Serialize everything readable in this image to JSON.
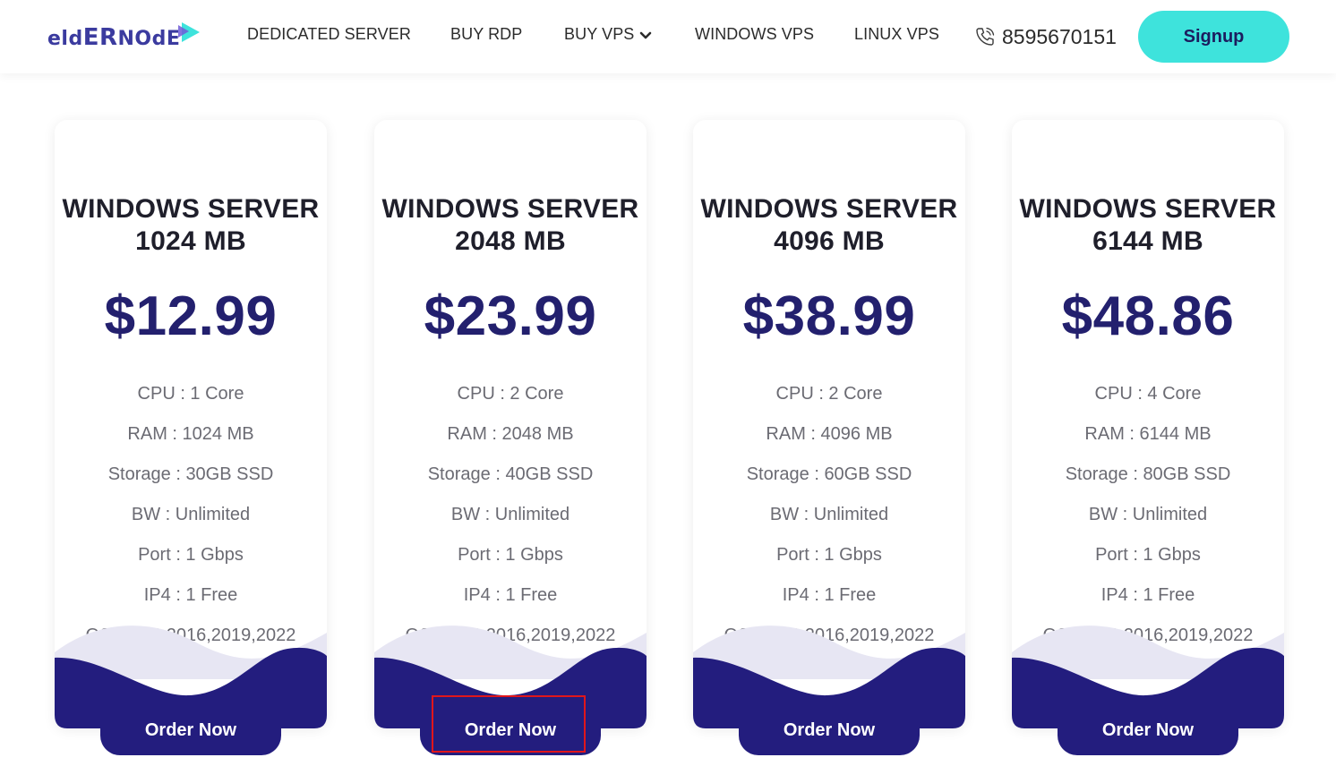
{
  "brand": {
    "logo_text_prefix": "eld",
    "logo_text_middle": "ER",
    "logo_text_suffix": "NOdE"
  },
  "nav": {
    "items": [
      "DEDICATED SERVER",
      "BUY RDP",
      "BUY VPS",
      "WINDOWS VPS",
      "LINUX VPS"
    ]
  },
  "contact": {
    "phone": "8595670151"
  },
  "signup_label": "Signup",
  "plans": [
    {
      "title_line1": "WINDOWS SERVER",
      "title_line2": "1024 MB",
      "price": "$12.99",
      "features": [
        "CPU : 1 Core",
        "RAM : 1024 MB",
        "Storage : 30GB SSD",
        "BW : Unlimited",
        "Port : 1 Gbps",
        "IP4 : 1 Free",
        "OS: 2012,2016,2019,2022"
      ],
      "order_label": "Order Now"
    },
    {
      "title_line1": "WINDOWS SERVER",
      "title_line2": "2048 MB",
      "price": "$23.99",
      "features": [
        "CPU : 2 Core",
        "RAM : 2048 MB",
        "Storage : 40GB SSD",
        "BW : Unlimited",
        "Port : 1 Gbps",
        "IP4 : 1 Free",
        "OS: 2012,2016,2019,2022"
      ],
      "order_label": "Order Now"
    },
    {
      "title_line1": "WINDOWS SERVER",
      "title_line2": "4096 MB",
      "price": "$38.99",
      "features": [
        "CPU : 2 Core",
        "RAM : 4096 MB",
        "Storage : 60GB SSD",
        "BW : Unlimited",
        "Port : 1 Gbps",
        "IP4 : 1 Free",
        "OS: 2012,2016,2019,2022"
      ],
      "order_label": "Order Now"
    },
    {
      "title_line1": "WINDOWS SERVER",
      "title_line2": "6144 MB",
      "price": "$48.86",
      "features": [
        "CPU : 4 Core",
        "RAM : 6144 MB",
        "Storage : 80GB SSD",
        "BW : Unlimited",
        "Port : 1 Gbps",
        "IP4 : 1 Free",
        "OS: 2012,2016,2019,2022"
      ],
      "order_label": "Order Now"
    }
  ],
  "colors": {
    "accent_cyan": "#3ee3dc",
    "brand_navy": "#231d7e",
    "price_navy": "#23206e",
    "wave_light": "#e7e6f3",
    "highlight_red": "#e0161b"
  }
}
